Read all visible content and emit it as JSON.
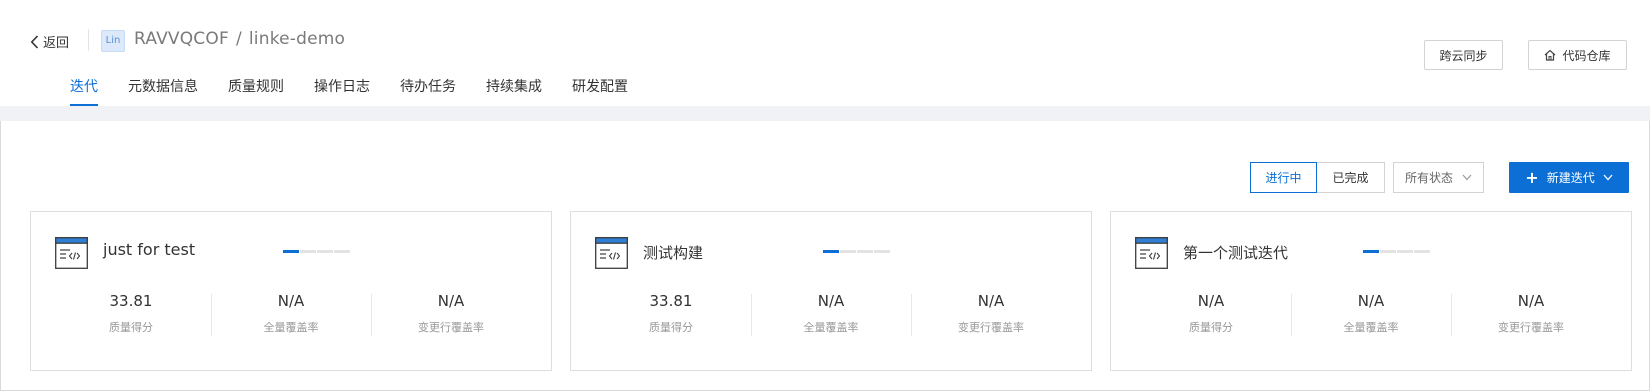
{
  "header": {
    "back_label": "返回",
    "avatar_text": "Lin",
    "project": "RAVVQCOF",
    "separator": "/",
    "repo": "linke-demo",
    "sync_label": "跨云同步",
    "repo_button_label": "代码仓库"
  },
  "tabs": [
    {
      "label": "迭代",
      "active": true
    },
    {
      "label": "元数据信息"
    },
    {
      "label": "质量规则"
    },
    {
      "label": "操作日志"
    },
    {
      "label": "待办任务"
    },
    {
      "label": "持续集成"
    },
    {
      "label": "研发配置"
    }
  ],
  "toolbar": {
    "in_progress_label": "进行中",
    "done_label": "已完成",
    "status_filter": "所有状态",
    "new_iteration_label": "新建迭代"
  },
  "cards": [
    {
      "title": "just for test",
      "progress_filled": 1,
      "progress_total": 4,
      "stats": [
        {
          "value": "33.81",
          "label": "质量得分"
        },
        {
          "value": "N/A",
          "label": "全量覆盖率"
        },
        {
          "value": "N/A",
          "label": "变更行覆盖率"
        }
      ]
    },
    {
      "title": "测试构建",
      "progress_filled": 1,
      "progress_total": 4,
      "stats": [
        {
          "value": "33.81",
          "label": "质量得分"
        },
        {
          "value": "N/A",
          "label": "全量覆盖率"
        },
        {
          "value": "N/A",
          "label": "变更行覆盖率"
        }
      ]
    },
    {
      "title": "第一个测试迭代",
      "progress_filled": 1,
      "progress_total": 4,
      "stats": [
        {
          "value": "N/A",
          "label": "质量得分"
        },
        {
          "value": "N/A",
          "label": "全量覆盖率"
        },
        {
          "value": "N/A",
          "label": "变更行覆盖率"
        }
      ]
    }
  ],
  "colors": {
    "accent": "#0b6fd6",
    "band": "#f0f2f5",
    "border": "#d3d3d3"
  },
  "icons": [
    "chevron-left-icon",
    "home-icon",
    "chevron-down-icon",
    "plus-icon",
    "code-window-icon"
  ]
}
